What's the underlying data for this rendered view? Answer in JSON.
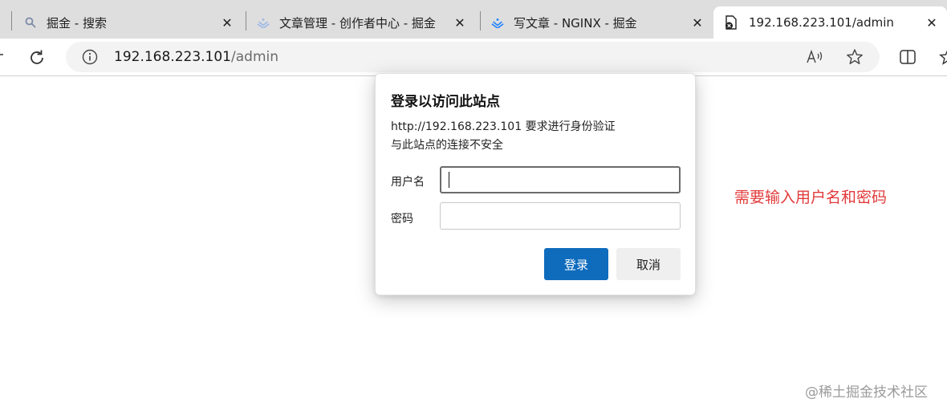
{
  "browser": {
    "tabs": [
      {
        "title": "掘金 - 搜索",
        "icon": "search-icon",
        "active": false
      },
      {
        "title": "文章管理 - 创作者中心 - 掘金",
        "icon": "juejin-icon",
        "active": false
      },
      {
        "title": "写文章 - NGINX - 掘金",
        "icon": "juejin-icon",
        "active": false
      },
      {
        "title": "192.168.223.101/admin",
        "icon": "page-insecure-icon",
        "active": true
      }
    ],
    "close_glyph": "✕",
    "address": {
      "host": "192.168.223.101",
      "path": "/admin"
    }
  },
  "dialog": {
    "title": "登录以访问此站点",
    "message_line1": "http://192.168.223.101 要求进行身份验证",
    "message_line2": "与此站点的连接不安全",
    "username_label": "用户名",
    "username_value": "",
    "password_label": "密码",
    "password_value": "",
    "login_button": "登录",
    "cancel_button": "取消"
  },
  "annotation": "需要输入用户名和密码",
  "watermark": "@稀土掘金技术社区",
  "colors": {
    "accent": "#0f6cbd",
    "annotation": "#e23b3b",
    "tab_strip": "#dedede",
    "juejin_blue": "#1e80ff"
  }
}
